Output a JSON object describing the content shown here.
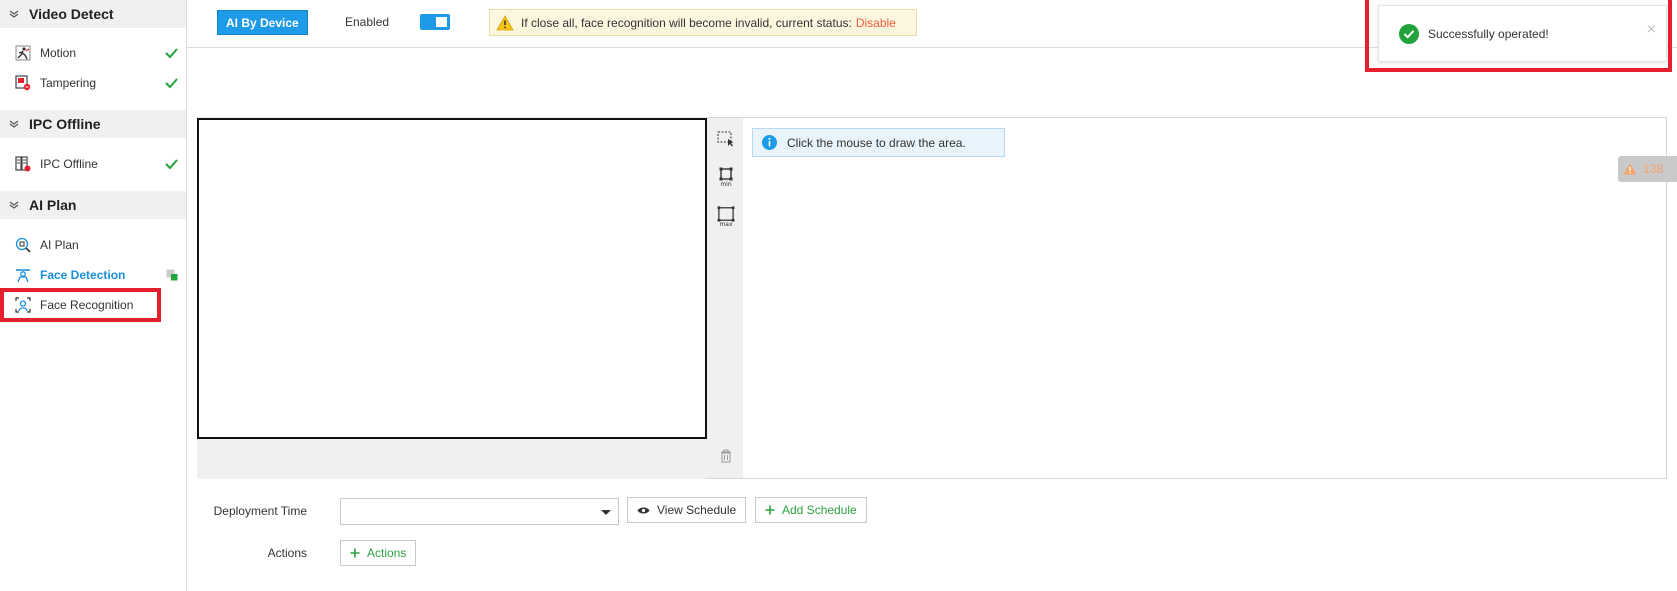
{
  "sidebar": {
    "groups": [
      {
        "title": "Video Detect"
      },
      {
        "title": "IPC Offline"
      },
      {
        "title": "AI Plan"
      }
    ],
    "items": [
      {
        "label": "Motion"
      },
      {
        "label": "Tampering"
      },
      {
        "label": "IPC Offline"
      },
      {
        "label": "AI Plan"
      },
      {
        "label": "Face Detection"
      },
      {
        "label": "Face Recognition"
      }
    ]
  },
  "topbar": {
    "ai_button": "AI By Device",
    "enabled_label": "Enabled",
    "toggle_on": true,
    "warning_text": "If close all, face recognition will become invalid, current status:",
    "warning_status": "Disable"
  },
  "toast": {
    "message": "Successfully operated!",
    "close": "×"
  },
  "drawing": {
    "info_text": "Click the mouse to draw the area.",
    "tools": [
      {
        "name": "select-area-tool"
      },
      {
        "name": "min-size-tool",
        "tag": "min"
      },
      {
        "name": "max-size-tool",
        "tag": "max"
      }
    ],
    "side_tab_count": "138"
  },
  "form": {
    "deployment_time_label": "Deployment Time",
    "deployment_time_value": "",
    "view_schedule": "View Schedule",
    "add_schedule": "Add Schedule",
    "actions_label": "Actions",
    "actions_button": "Actions"
  },
  "colors": {
    "accent": "#1e9be8",
    "success": "#22a33c",
    "danger_outline": "#e5202e",
    "status_red": "#f15b3c"
  }
}
